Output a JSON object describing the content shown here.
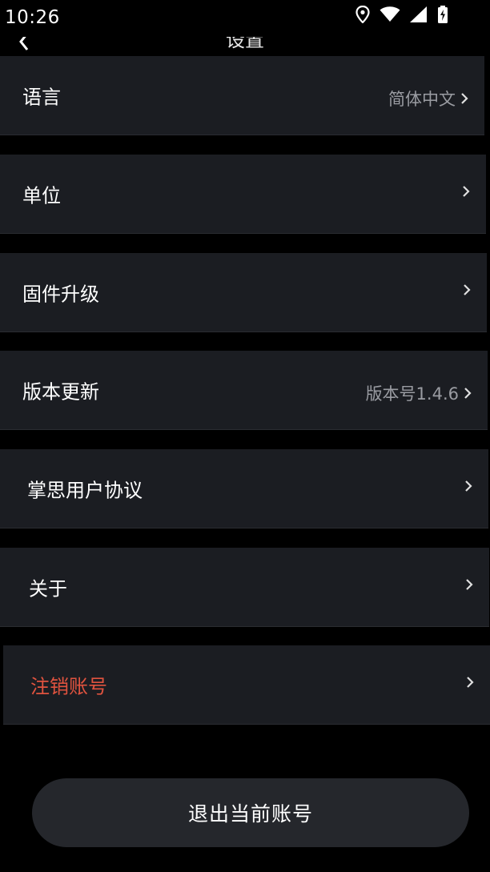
{
  "status_bar": {
    "time": "10:26",
    "icons": [
      "location-icon",
      "wifi-icon",
      "cellular-signal-icon",
      "battery-charging-icon"
    ]
  },
  "header": {
    "title": "设置",
    "back_icon": "chevron-left-icon"
  },
  "settings": {
    "items": [
      {
        "label": "语言",
        "value": "简体中文"
      },
      {
        "label": "单位",
        "value": ""
      },
      {
        "label": "固件升级",
        "value": ""
      },
      {
        "label": "版本更新",
        "value": "版本号1.4.6"
      },
      {
        "label": "掌思用户协议",
        "value": ""
      },
      {
        "label": "关于",
        "value": ""
      },
      {
        "label": "注销账号",
        "value": "",
        "style": "danger",
        "color": "#e0533f"
      }
    ]
  },
  "logout": {
    "label": "退出当前账号"
  },
  "colors": {
    "background": "#000000",
    "row_background": "#1b1d22",
    "danger": "#e0533f",
    "secondary_text": "#9a9ca2"
  }
}
